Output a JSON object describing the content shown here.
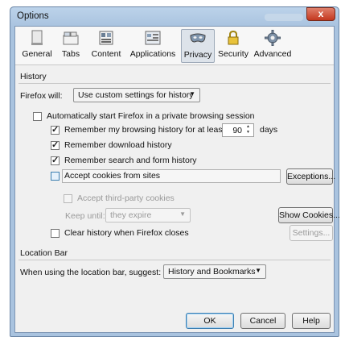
{
  "window": {
    "title": "Options",
    "close_label": "x"
  },
  "tabs": [
    {
      "label": "General",
      "icon": "general-icon"
    },
    {
      "label": "Tabs",
      "icon": "tabs-icon"
    },
    {
      "label": "Content",
      "icon": "content-icon"
    },
    {
      "label": "Applications",
      "icon": "applications-icon"
    },
    {
      "label": "Privacy",
      "icon": "privacy-mask-icon",
      "selected": true
    },
    {
      "label": "Security",
      "icon": "lock-icon"
    },
    {
      "label": "Advanced",
      "icon": "gear-icon"
    }
  ],
  "history": {
    "group_label": "History",
    "will_label": "Firefox will:",
    "will_value": "Use custom settings for history",
    "private_label": "Automatically start Firefox in a private browsing session",
    "private_checked": false,
    "remember_browsing_label": "Remember my browsing history for at least",
    "remember_browsing_checked": true,
    "days_value": "90",
    "days_label": "days",
    "remember_download_label": "Remember download history",
    "remember_download_checked": true,
    "remember_search_label": "Remember search and form history",
    "remember_search_checked": true,
    "accept_cookies_label": "Accept cookies from sites",
    "accept_cookies_checked": false,
    "exceptions_label": "Exceptions...",
    "third_party_label": "Accept third-party cookies",
    "keep_until_label": "Keep until:",
    "keep_until_value": "they expire",
    "show_cookies_label": "Show Cookies...",
    "clear_history_label": "Clear history when Firefox closes",
    "clear_history_checked": false,
    "settings_label": "Settings..."
  },
  "location_bar": {
    "group_label": "Location Bar",
    "suggest_label": "When using the location bar, suggest:",
    "suggest_value": "History and Bookmarks"
  },
  "footer": {
    "ok_label": "OK",
    "cancel_label": "Cancel",
    "help_label": "Help"
  }
}
